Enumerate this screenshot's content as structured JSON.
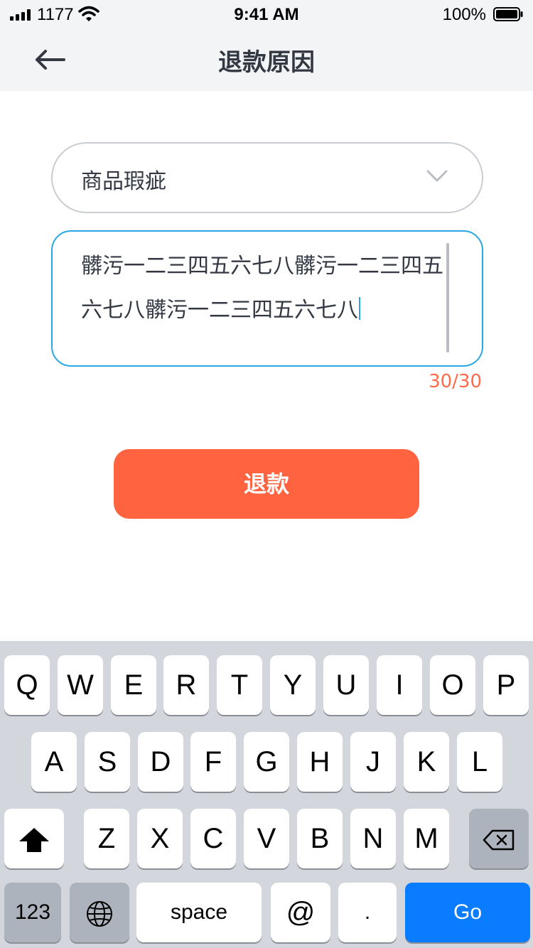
{
  "status_bar": {
    "carrier": "1177",
    "time": "9:41 AM",
    "battery": "100%"
  },
  "nav": {
    "title": "退款原因",
    "back_icon": "arrow-left-icon"
  },
  "reason_select": {
    "value": "商品瑕疵",
    "icon": "chevron-down-icon"
  },
  "reason_text": {
    "value": "髒污一二三四五六七八髒污一二三四五六七八髒污一二三四五六七八",
    "counter": "30/30"
  },
  "submit": {
    "label": "退款",
    "color": "#ff6340"
  },
  "keyboard": {
    "row1": [
      "Q",
      "W",
      "E",
      "R",
      "T",
      "Y",
      "U",
      "I",
      "O",
      "P"
    ],
    "row2": [
      "A",
      "S",
      "D",
      "F",
      "G",
      "H",
      "J",
      "K",
      "L"
    ],
    "row3": [
      "Z",
      "X",
      "C",
      "V",
      "B",
      "N",
      "M"
    ],
    "numbers_label": "123",
    "space_label": "space",
    "at_label": "@",
    "dot_label": ".",
    "go_label": "Go"
  }
}
